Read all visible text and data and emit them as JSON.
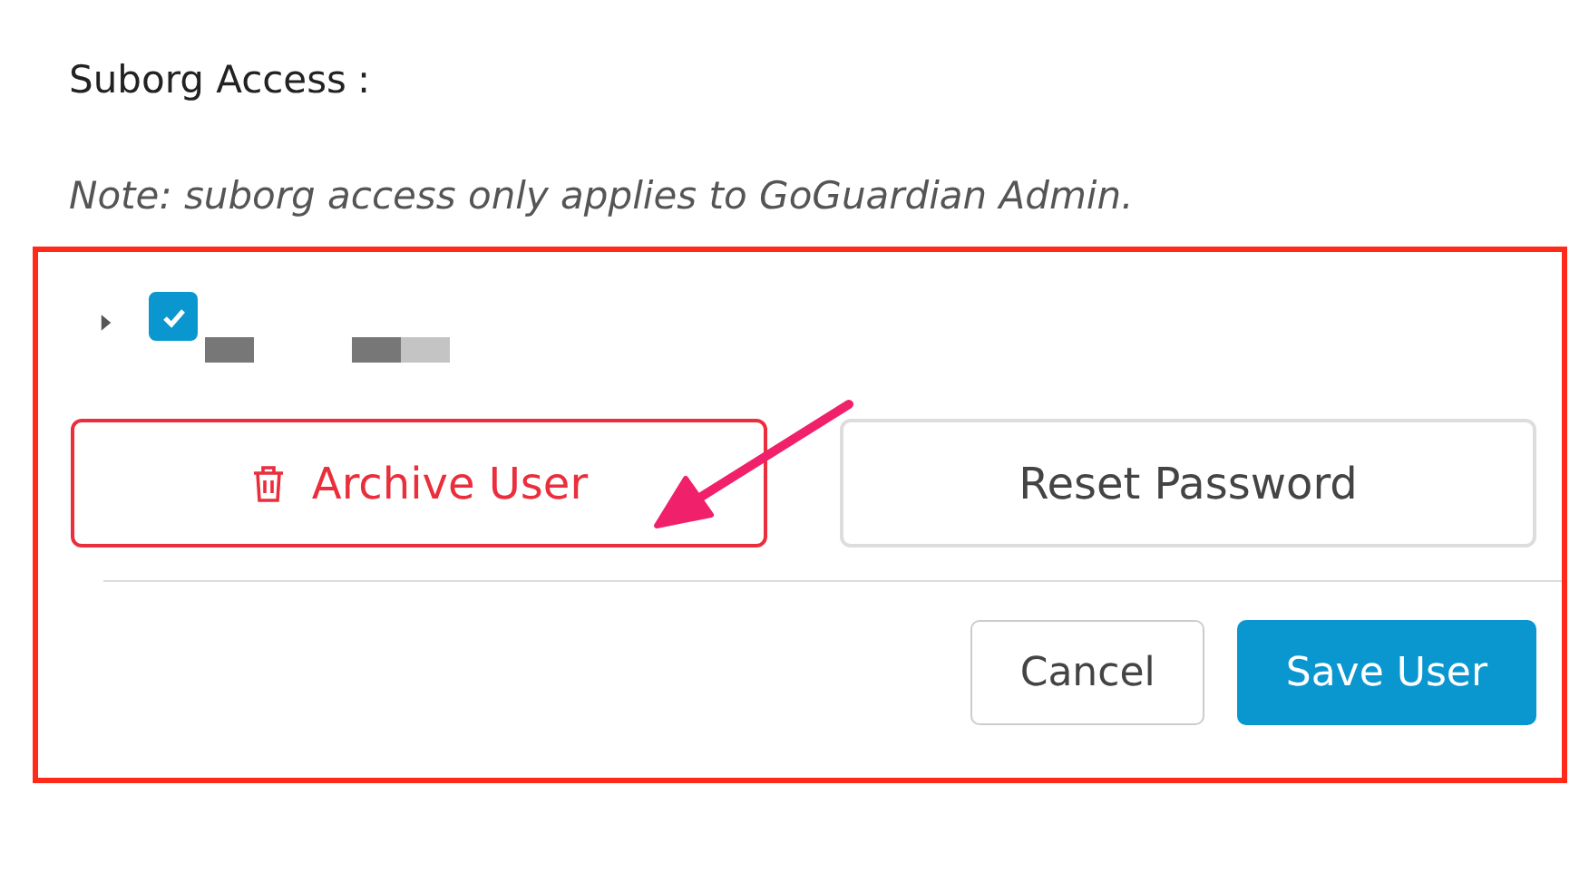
{
  "section_label": "Suborg Access",
  "label_colon": ":",
  "note": "Note: suborg access only applies to GoGuardian Admin.",
  "tree_items": [
    {
      "expanded": false,
      "checked": true
    }
  ],
  "actions": [
    {
      "label": "Archive User",
      "kind": "danger"
    },
    {
      "label": "Reset Password",
      "kind": "default"
    }
  ],
  "footer_buttons": [
    {
      "label": "Cancel",
      "kind": "default"
    },
    {
      "label": "Save User",
      "kind": "primary"
    }
  ]
}
